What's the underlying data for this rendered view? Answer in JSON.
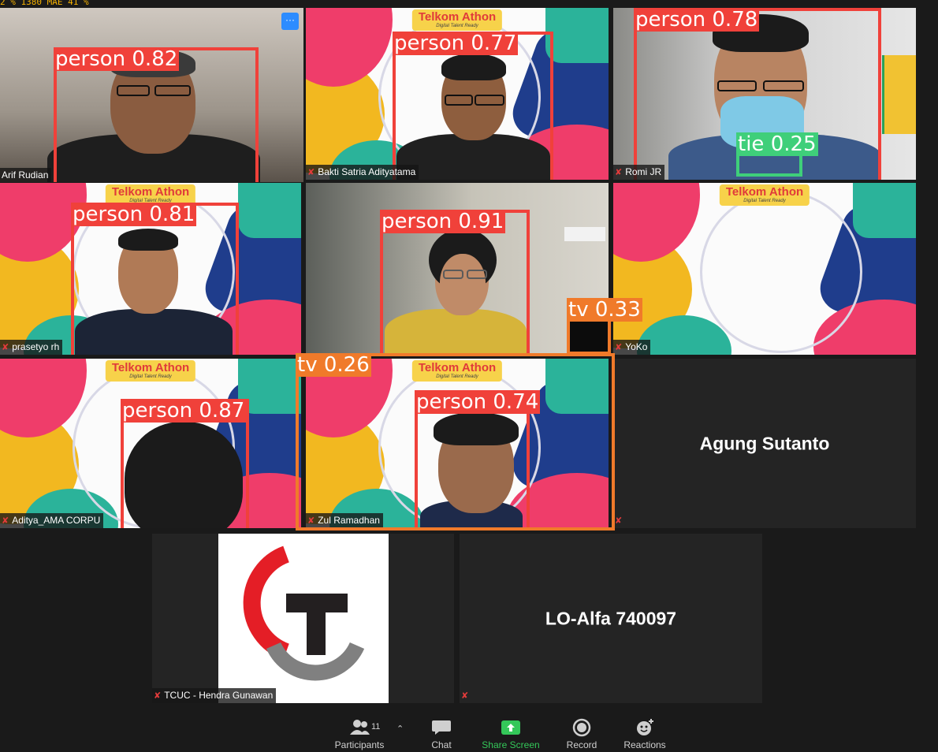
{
  "status_bar": {
    "text": "2 %    1380 MAE     41 %"
  },
  "participants_grid": [
    {
      "name": "Arif Rudian",
      "detection": {
        "label": "person",
        "score": "0.82"
      }
    },
    {
      "name": "Bakti Satria Adityatama",
      "detection": {
        "label": "person",
        "score": "0.77"
      }
    },
    {
      "name": "Romi JR",
      "detections": [
        {
          "label": "person",
          "score": "0.78"
        },
        {
          "label": "tie",
          "score": "0.25"
        }
      ]
    },
    {
      "name": "prasetyo rh",
      "detection": {
        "label": "person",
        "score": "0.81"
      }
    },
    {
      "name": "",
      "detections": [
        {
          "label": "person",
          "score": "0.91"
        },
        {
          "label": "tv",
          "score": "0.33"
        }
      ]
    },
    {
      "name": "YoKo"
    },
    {
      "name": "Aditya_AMA CORPU",
      "detection": {
        "label": "person",
        "score": "0.87"
      }
    },
    {
      "name": "Zul Ramadhan",
      "detections": [
        {
          "label": "tv",
          "score": "0.26"
        },
        {
          "label": "person",
          "score": "0.74"
        }
      ]
    },
    {
      "name": "Agung Sutanto"
    },
    {
      "name": "TCUC - Hendra Gunawan"
    },
    {
      "name": "LO-Alfa 740097"
    }
  ],
  "background_logo": {
    "title": "Telkom Athon",
    "subtitle": "Digital Talent Ready"
  },
  "more_button": {
    "label": "···"
  },
  "toolbar": {
    "participants": {
      "label": "Participants",
      "count": "11"
    },
    "chat": {
      "label": "Chat"
    },
    "share_screen": {
      "label": "Share Screen"
    },
    "record": {
      "label": "Record"
    },
    "reactions": {
      "label": "Reactions"
    }
  },
  "colors": {
    "detection_person": "#f0413a",
    "detection_tv": "#f07a2a",
    "detection_tie": "#3fcf7a",
    "share_screen_green": "#34c759",
    "active_speaker": "#b9e36b"
  }
}
